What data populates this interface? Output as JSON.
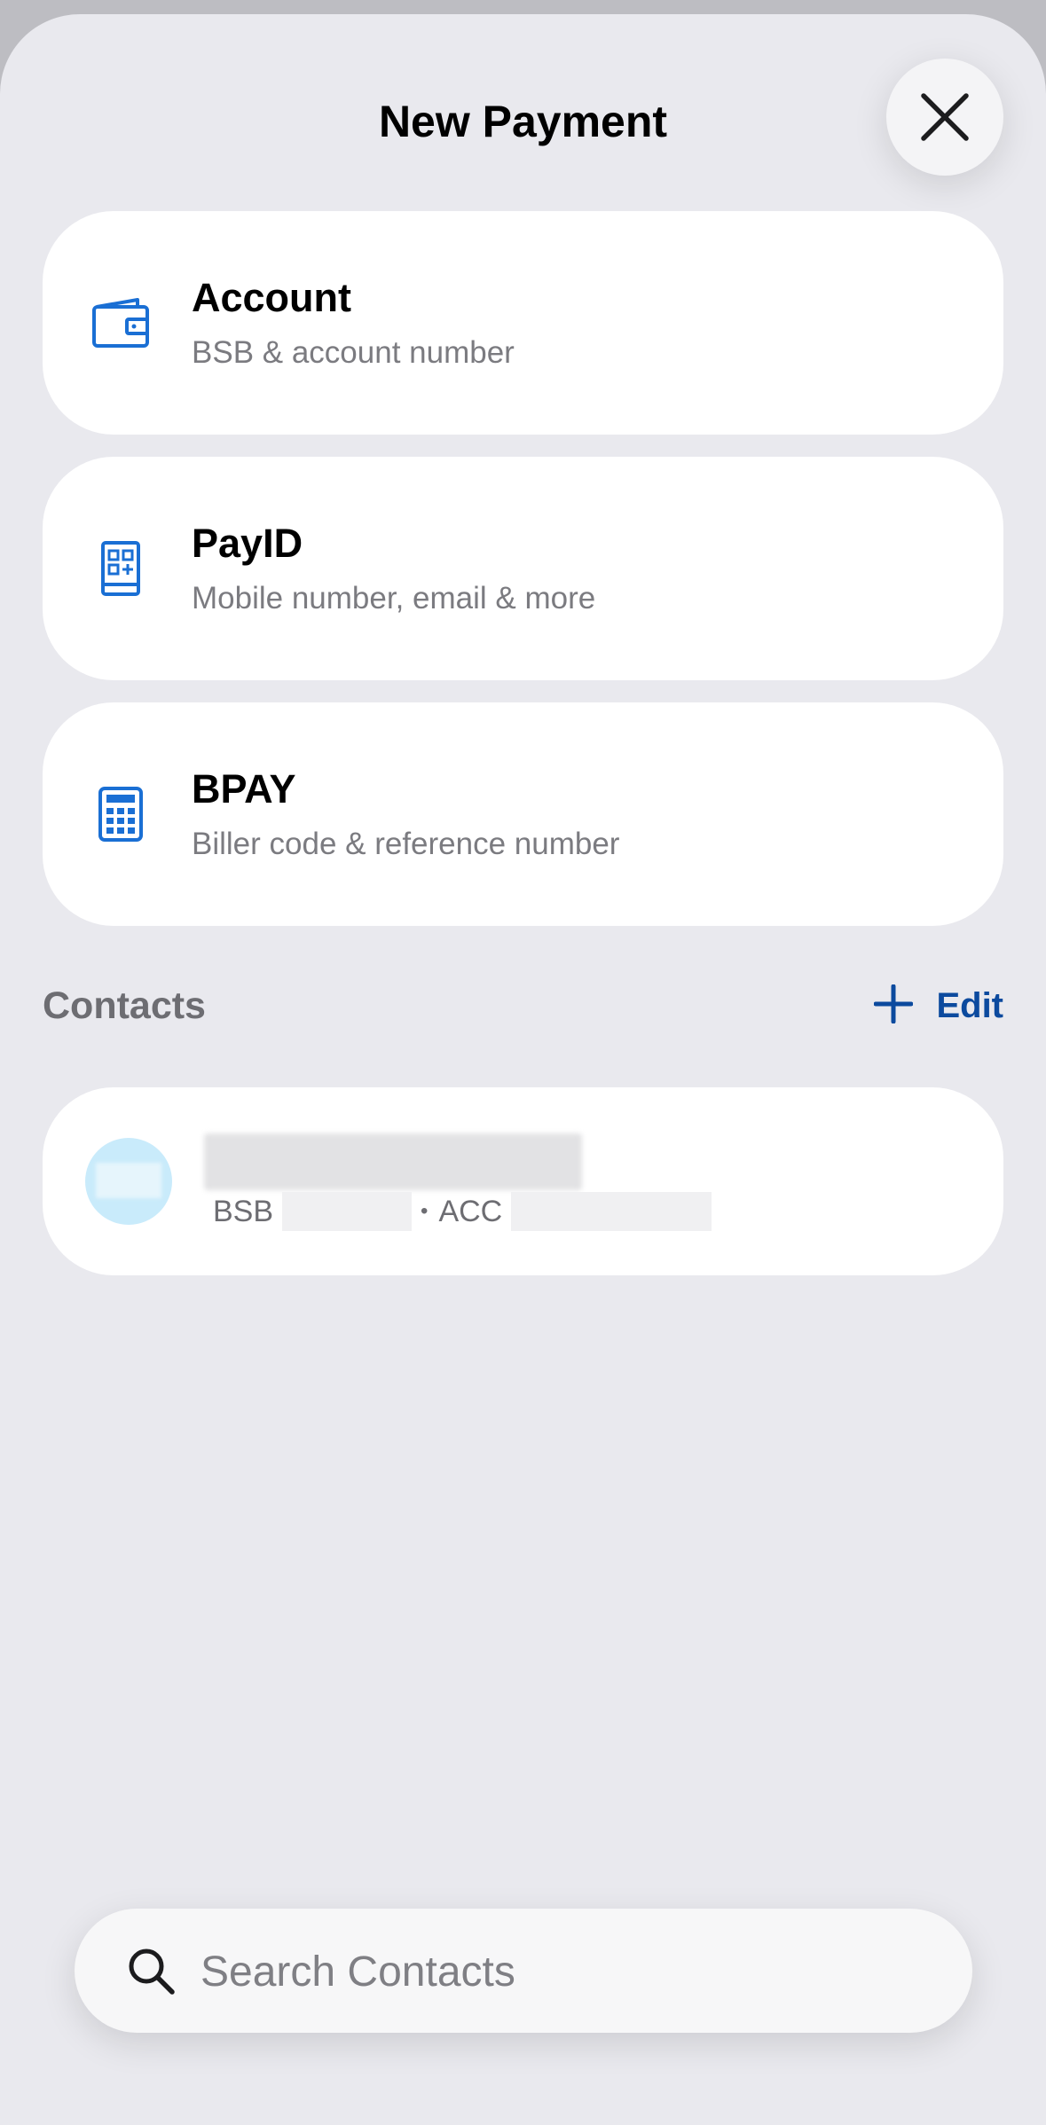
{
  "header": {
    "title": "New Payment"
  },
  "payment_options": [
    {
      "label": "Account",
      "description": "BSB & account number",
      "icon": "wallet-icon"
    },
    {
      "label": "PayID",
      "description": "Mobile number, email & more",
      "icon": "payid-icon"
    },
    {
      "label": "BPAY",
      "description": "Biller code & reference number",
      "icon": "calculator-icon"
    }
  ],
  "contacts": {
    "section_title": "Contacts",
    "edit_label": "Edit",
    "add_icon": "plus-icon",
    "items": [
      {
        "bsb_label": "BSB",
        "separator": "•",
        "acc_label": "ACC"
      }
    ]
  },
  "search": {
    "placeholder": "Search Contacts"
  },
  "colors": {
    "accent_icon": "#1a6fd4",
    "link": "#0c4a9e",
    "background": "#e9e9ee",
    "avatar": "#c9ebfb"
  }
}
